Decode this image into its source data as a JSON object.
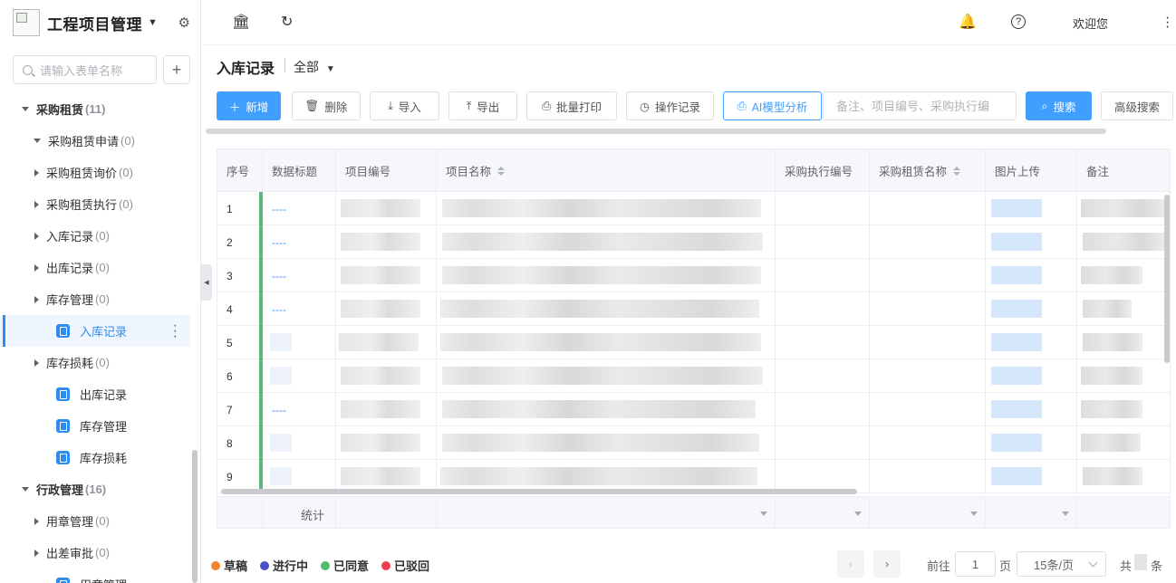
{
  "brand": {
    "title": "工程项目管理"
  },
  "sidebar": {
    "search_placeholder": "请输入表单名称",
    "add_label": "+",
    "items": [
      {
        "label": "采购租赁",
        "count": "(11)"
      },
      {
        "label": "采购租赁申请",
        "count": "(0)"
      },
      {
        "label": "采购租赁询价",
        "count": "(0)"
      },
      {
        "label": "采购租赁执行",
        "count": "(0)"
      },
      {
        "label": "入库记录",
        "count": "(0)"
      },
      {
        "label": "出库记录",
        "count": "(0)"
      },
      {
        "label": "库存管理",
        "count": "(0)"
      },
      {
        "label": "入库记录",
        "count": ""
      },
      {
        "label": "库存损耗",
        "count": "(0)"
      },
      {
        "label": "出库记录",
        "count": ""
      },
      {
        "label": "库存管理",
        "count": ""
      },
      {
        "label": "库存损耗",
        "count": ""
      },
      {
        "label": "行政管理",
        "count": "(16)"
      },
      {
        "label": "用章管理",
        "count": "(0)"
      },
      {
        "label": "出差审批",
        "count": "(0)"
      },
      {
        "label": "用章管理",
        "count": ""
      }
    ]
  },
  "topbar": {
    "welcome": "欢迎您"
  },
  "page": {
    "title": "入库记录",
    "filter": "全部"
  },
  "toolbar": {
    "new": "新增",
    "delete": "删除",
    "import": "导入",
    "export": "导出",
    "print": "批量打印",
    "log": "操作记录",
    "ai": "AI模型分析",
    "search_placeholder": "备注、项目编号、采购执行编",
    "search": "搜索",
    "advanced": "高级搜索"
  },
  "table": {
    "columns": [
      "序号",
      "数据标题",
      "项目编号",
      "项目名称",
      "采购执行编号",
      "采购租赁名称",
      "图片上传",
      "备注"
    ],
    "rows": [
      {
        "index": "1",
        "title": "----"
      },
      {
        "index": "2",
        "title": "----"
      },
      {
        "index": "3",
        "title": "----"
      },
      {
        "index": "4",
        "title": "----"
      },
      {
        "index": "5",
        "title": ""
      },
      {
        "index": "6",
        "title": ""
      },
      {
        "index": "7",
        "title": "----"
      },
      {
        "index": "8",
        "title": ""
      },
      {
        "index": "9",
        "title": ""
      }
    ],
    "footer_label": "统计"
  },
  "legend": [
    {
      "label": "草稿",
      "color": "#f5832b"
    },
    {
      "label": "进行中",
      "color": "#4b4fc8"
    },
    {
      "label": "已同意",
      "color": "#4ebd6f"
    },
    {
      "label": "已驳回",
      "color": "#ec4052"
    }
  ],
  "pagination": {
    "goto_label": "前往",
    "page": "1",
    "page_unit": "页",
    "page_size": "15条/页",
    "total_prefix": "共",
    "total_suffix": "条"
  },
  "colors": {
    "accent": "#409eff",
    "active_bar": "#2d8cf0",
    "status_green": "#5cb87a"
  }
}
